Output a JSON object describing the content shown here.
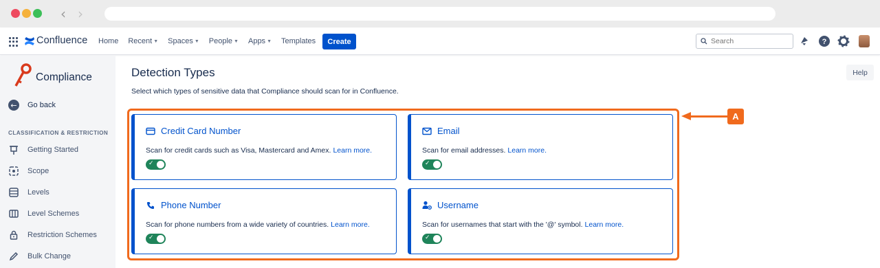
{
  "browser": {
    "back_glyph": "‹",
    "forward_glyph": "›"
  },
  "topbar": {
    "brand": "Confluence",
    "nav": [
      {
        "label": "Home",
        "dropdown": false
      },
      {
        "label": "Recent",
        "dropdown": true
      },
      {
        "label": "Spaces",
        "dropdown": true
      },
      {
        "label": "People",
        "dropdown": true
      },
      {
        "label": "Apps",
        "dropdown": true
      },
      {
        "label": "Templates",
        "dropdown": false
      }
    ],
    "create_label": "Create",
    "search_placeholder": "Search",
    "icons": [
      "grid-icon",
      "confluence-logo-icon",
      "notifications-icon",
      "help-icon",
      "settings-icon",
      "avatar"
    ]
  },
  "sidebar": {
    "title": "Compliance",
    "go_back": "Go back",
    "section": "CLASSIFICATION & RESTRICTION",
    "items": [
      {
        "label": "Getting Started",
        "icon": "pin-icon"
      },
      {
        "label": "Scope",
        "icon": "scope-icon"
      },
      {
        "label": "Levels",
        "icon": "levels-icon"
      },
      {
        "label": "Level Schemes",
        "icon": "level-schemes-icon"
      },
      {
        "label": "Restriction Schemes",
        "icon": "lock-icon"
      },
      {
        "label": "Bulk Change",
        "icon": "pencil-icon"
      }
    ]
  },
  "main": {
    "title": "Detection Types",
    "description": "Select which types of sensitive data that Compliance should scan for in Confluence.",
    "help_label": "Help",
    "callout_marker": "A",
    "cards": [
      {
        "title": "Credit Card Number",
        "icon": "credit-card-icon",
        "desc": "Scan for credit cards such as Visa, Mastercard and Amex.",
        "link": "Learn more.",
        "enabled": true
      },
      {
        "title": "Email",
        "icon": "email-icon",
        "desc": "Scan for email addresses.",
        "link": "Learn more.",
        "enabled": true
      },
      {
        "title": "Phone Number",
        "icon": "phone-icon",
        "desc": "Scan for phone numbers from a wide variety of countries.",
        "link": "Learn more.",
        "enabled": true
      },
      {
        "title": "Username",
        "icon": "user-at-icon",
        "desc": "Scan for usernames that start with the '@' symbol.",
        "link": "Learn more.",
        "enabled": true
      }
    ],
    "colors": {
      "accent": "#0052cc",
      "toggle_on": "#1f845a",
      "callout": "#f06a1d"
    }
  }
}
